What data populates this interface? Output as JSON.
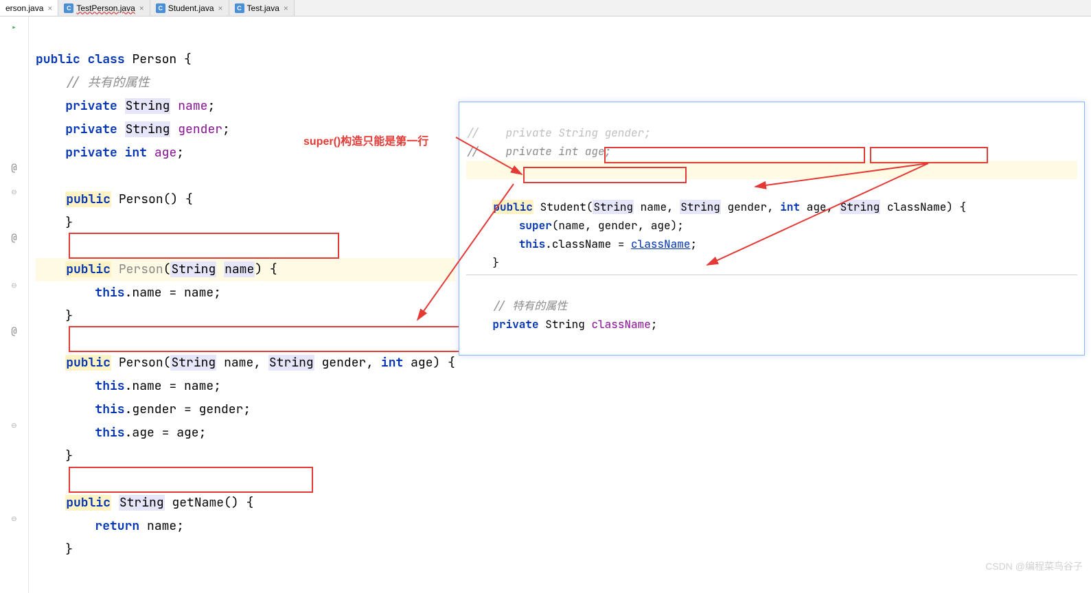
{
  "tabs": [
    {
      "label": "erson.java"
    },
    {
      "label": "TestPerson.java",
      "err": true
    },
    {
      "label": "Student.java"
    },
    {
      "label": "Test.java"
    }
  ],
  "annotation": "super()构造只能是第一行",
  "code": {
    "l1a": "public",
    "l1b": "class",
    "l1c": "Person {",
    "l2": "// 共有的属性",
    "l3a": "private",
    "l3b": "String",
    "l3c": "name",
    "l3d": ";",
    "l4a": "private",
    "l4b": "String",
    "l4c": "gender",
    "l4d": ";",
    "l5a": "private",
    "l5b": "int",
    "l5c": "age",
    "l5d": ";",
    "l7a": "public",
    "l7b": "Person() {",
    "l8": "}",
    "l10a": "public",
    "l10b": "Person",
    "l10c": "(",
    "l10d": "String",
    "l10e": "name",
    "l10f": ") {",
    "l11a": "this",
    "l11b": ".name = name;",
    "l12": "}",
    "l14a": "public",
    "l14b": "Person(",
    "l14c": "String",
    "l14d": "name, ",
    "l14e": "String",
    "l14f": "gender, ",
    "l14g": "int",
    "l14h": "age) {",
    "l15a": "this",
    "l15b": ".name = name;",
    "l16a": "this",
    "l16b": ".gender = gender;",
    "l17a": "this",
    "l17b": ".age = age;",
    "l18": "}",
    "l20a": "public",
    "l20b": "String",
    "l20c": "getName() {",
    "l21a": "return",
    "l21b": "name;",
    "l22": "}"
  },
  "overlay": {
    "c0a": "//    private String gender;",
    "c1": "//    private int age;",
    "c3a": "public",
    "c3b": "Student(",
    "c3c": "String",
    "c3d": "name, ",
    "c3e": "String",
    "c3f": "gender, ",
    "c3g": "int",
    "c3h": "age,",
    "c3i": "String",
    "c3j": "className",
    "c3k": ") {",
    "c4a": "super",
    "c4b": "(name, gender, age);",
    "c5a": "this",
    "c5b": ".className = ",
    "c5c": "className",
    "c5d": ";",
    "c6": "}",
    "c8": "// 特有的属性",
    "c9a": "private",
    "c9b": "String",
    "c9c": "className",
    "c9d": ";"
  },
  "watermark": "CSDN @编程菜鸟谷子"
}
